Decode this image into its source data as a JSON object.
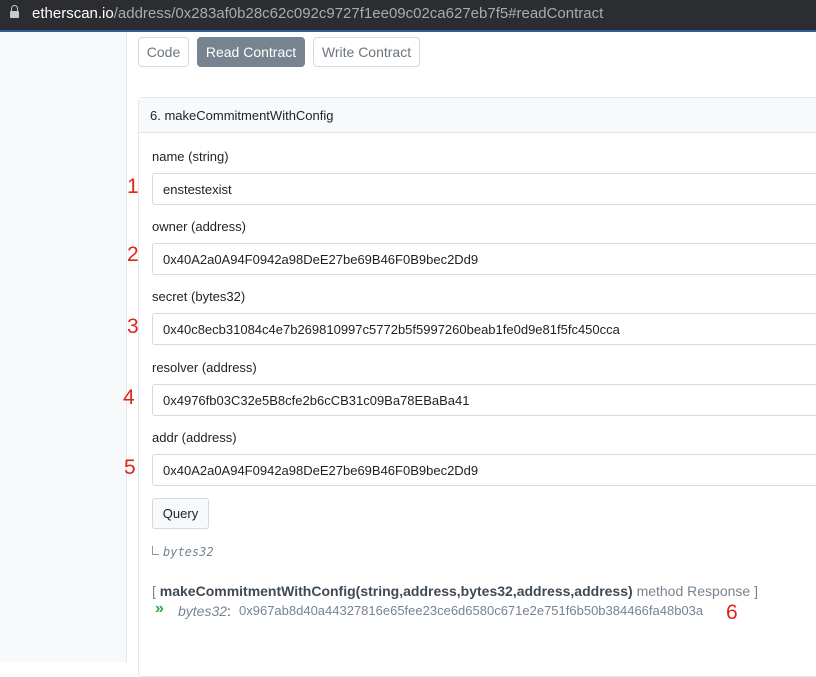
{
  "browser": {
    "url_host": "etherscan.io",
    "url_path": "/address/0x283af0b28c62c092c9727f1ee09c02ca627eb7f5#readContract"
  },
  "tabs": [
    "Code",
    "Read Contract",
    "Write Contract"
  ],
  "active_tab": "Read Contract",
  "method": {
    "title": "6. makeCommitmentWithConfig",
    "fields": [
      {
        "label": "name (string)",
        "value": "enstestexist",
        "marker": "1"
      },
      {
        "label": "owner (address)",
        "value": "0x40A2a0A94F0942a98DeE27be69B46F0B9bec2Dd9",
        "marker": "2"
      },
      {
        "label": "secret (bytes32)",
        "value": "0x40c8ecb31084c4e7b269810997c5772b5f5997260beab1fe0d9e81f5fc450cca",
        "marker": "3"
      },
      {
        "label": "resolver (address)",
        "value": "0x4976fb03C32e5B8cfe2b6cCB31c09Ba78EBaBa41",
        "marker": "4"
      },
      {
        "label": "addr (address)",
        "value": "0x40A2a0A94F0942a98DeE27be69B46F0B9bec2Dd9",
        "marker": "5"
      }
    ],
    "query_label": "Query",
    "return_type": "bytes32"
  },
  "response": {
    "open_bracket": "[",
    "signature": "makeCommitmentWithConfig(string,address,bytes32,address,address)",
    "suffix": "method Response ]",
    "chevron": "»",
    "result_type": "bytes32",
    "colon": ":",
    "result_value": "0x967ab8d40a44327816e65fee23ce6d6580c671e2e751f6b50b384466fa48b03a",
    "marker": "6"
  },
  "colors": {
    "active_tab": "#77838f",
    "marker": "#e2231a",
    "chevron": "#28a745"
  }
}
